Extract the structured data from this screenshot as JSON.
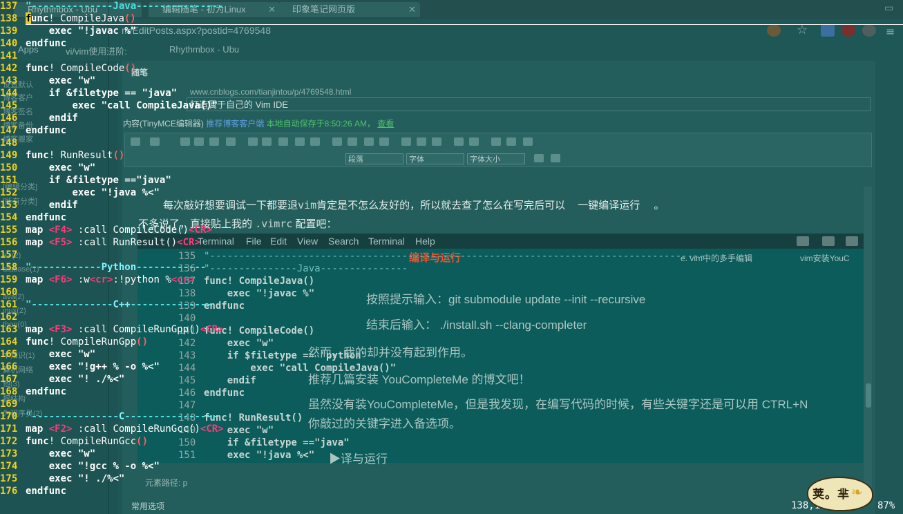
{
  "browser": {
    "tabs": [
      {
        "label": "Rhythmbox - Ubu"
      },
      {
        "label": "编辑随笔 - 初为Linux"
      },
      {
        "label": "印象笔记网页版"
      }
    ],
    "url": "m/EditPosts.aspx?postid=4769548",
    "bookmarks": [
      "Apps",
      "vi/vim使用进阶: ",
      "Rhythmbox - Ubu"
    ],
    "sidebar_items": [
      "设置默认",
      "博客客户",
      "博客签名",
      "博客备份",
      "博客搬家",
      "[编辑分类]",
      "[所有分类]",
      "++(2)",
      "atabase(1)",
      "ava(2)",
      "inux(2)",
      "thon(0)",
      "本知识(1)",
      "算机网络",
      "他(3)",
      "据结构",
      "为程序员(2)"
    ],
    "section_title": "随笔",
    "post_link": "www.cnblogs.com/tianjintou/p/4769548.html",
    "post_title": "打造属于自己的 Vim IDE",
    "content_label": "内容(TinyMCE编辑器)",
    "content_link": "推荐博客客户端",
    "autosave_note": "本地自动保存于8:50:26 AM，",
    "autosave_link": "查看",
    "format_select": "段落",
    "font_select": "字体",
    "size_select": "字体大小",
    "body_line_1": "每次敲好想要调试一下都要退",
    "body_line_1_code": "vim",
    "body_line_1_rest": "肯定是不怎么友好的，所以就去查了怎么在写完后可以",
    "body_line_1_end": "一键编译运行",
    "body_line_1_dot": "。",
    "body_line_2": "不多说了，直接贴上我的",
    "body_line_2_code": ".vimrc",
    "body_line_2_rest": "配置吧：",
    "path_label": "元素路径: p",
    "footer_label": "常用选项"
  },
  "terminal": {
    "menu": [
      "Terminal",
      "File",
      "Edit",
      "View",
      "Search",
      "Terminal",
      "Help"
    ],
    "heading": "编译与运行",
    "overlay_lines": [
      "按照提示输入：git submodule update --init --recursive",
      "结束后输入：   ./install.sh --clang-completer",
      "然而，我的却并没有起到作用。",
      "推荐几篇安装",
      "YouCompleteMe",
      "的博文吧！",
      "虽然没有装YouCompleteMe，但是我发现，在编写代码的时候，有些关键字还是可以用 CTRL+N",
      "你敲过的关键字进入备选项。",
      "e. vim中的多手编辑",
      "vim安装YouC",
      "▶译与运行"
    ],
    "code_lines": [
      {
        "n": "135",
        "t": "\"-------------------------------------------------------------------------------------"
      },
      {
        "n": "136",
        "t": "\"---------------Java---------------"
      },
      {
        "n": "137",
        "t": "func! CompileJava()"
      },
      {
        "n": "138",
        "t": "    exec \"!javac %\""
      },
      {
        "n": "139",
        "t": "endfunc"
      },
      {
        "n": "140",
        "t": ""
      },
      {
        "n": "141",
        "t": "func! CompileCode()"
      },
      {
        "n": "142",
        "t": "    exec \"w\""
      },
      {
        "n": "143",
        "t": "    if $filetype == \"python\""
      },
      {
        "n": "144",
        "t": "        exec \"call CompileJava()\""
      },
      {
        "n": "145",
        "t": "    endif"
      },
      {
        "n": "146",
        "t": "endfunc"
      },
      {
        "n": "147",
        "t": ""
      },
      {
        "n": "148",
        "t": "func! RunResult()"
      },
      {
        "n": "149",
        "t": "    exec \"w\""
      },
      {
        "n": "150",
        "t": "    if &filetype ==\"java\""
      },
      {
        "n": "151",
        "t": "    exec \"!java %<\""
      }
    ]
  },
  "vim": {
    "lines": [
      {
        "n": "137",
        "parts": [
          [
            "cmt",
            "\"--------------Java---------------"
          ]
        ]
      },
      {
        "n": "138",
        "parts": [
          [
            "cursor",
            "f"
          ],
          [
            "fn",
            "unc"
          ],
          [
            "id",
            "! CompileJava"
          ],
          [
            "paren",
            "()"
          ]
        ]
      },
      {
        "n": "139",
        "parts": [
          [
            "id",
            "    "
          ],
          [
            "fn",
            "exec"
          ],
          [
            "id",
            " "
          ],
          [
            "str",
            "\"!javac %\""
          ]
        ]
      },
      {
        "n": "140",
        "parts": [
          [
            "fn",
            "endfunc"
          ]
        ]
      },
      {
        "n": "141",
        "parts": []
      },
      {
        "n": "142",
        "parts": [
          [
            "fn",
            "func"
          ],
          [
            "id",
            "! CompileCode"
          ],
          [
            "paren",
            "()"
          ]
        ]
      },
      {
        "n": "143",
        "parts": [
          [
            "id",
            "    "
          ],
          [
            "fn",
            "exec"
          ],
          [
            "id",
            " "
          ],
          [
            "str",
            "\"w\""
          ]
        ]
      },
      {
        "n": "144",
        "parts": [
          [
            "id",
            "    "
          ],
          [
            "fn",
            "if"
          ],
          [
            "id",
            " "
          ],
          [
            "fn",
            "&filetype"
          ],
          [
            "id",
            " == "
          ],
          [
            "str",
            "\"java\""
          ]
        ]
      },
      {
        "n": "145",
        "parts": [
          [
            "id",
            "        "
          ],
          [
            "fn",
            "exec"
          ],
          [
            "id",
            " "
          ],
          [
            "str",
            "\"call CompileJava()\""
          ]
        ]
      },
      {
        "n": "146",
        "parts": [
          [
            "id",
            "    "
          ],
          [
            "fn",
            "endif"
          ]
        ]
      },
      {
        "n": "147",
        "parts": [
          [
            "fn",
            "endfunc"
          ]
        ]
      },
      {
        "n": "148",
        "parts": []
      },
      {
        "n": "149",
        "parts": [
          [
            "fn",
            "func"
          ],
          [
            "id",
            "! RunResult"
          ],
          [
            "paren",
            "()"
          ]
        ]
      },
      {
        "n": "150",
        "parts": [
          [
            "id",
            "    "
          ],
          [
            "fn",
            "exec"
          ],
          [
            "id",
            " "
          ],
          [
            "str",
            "\"w\""
          ]
        ]
      },
      {
        "n": "151",
        "parts": [
          [
            "id",
            "    "
          ],
          [
            "fn",
            "if"
          ],
          [
            "id",
            " "
          ],
          [
            "fn",
            "&filetype"
          ],
          [
            "id",
            " =="
          ],
          [
            "str",
            "\"java\""
          ]
        ]
      },
      {
        "n": "152",
        "parts": [
          [
            "id",
            "        "
          ],
          [
            "fn",
            "exec"
          ],
          [
            "id",
            " "
          ],
          [
            "str",
            "\"!java %<\""
          ]
        ]
      },
      {
        "n": "153",
        "parts": [
          [
            "id",
            "    "
          ],
          [
            "fn",
            "endif"
          ]
        ]
      },
      {
        "n": "154",
        "parts": [
          [
            "fn",
            "endfunc"
          ]
        ]
      },
      {
        "n": "155",
        "parts": [
          [
            "fn",
            "map"
          ],
          [
            "id",
            " "
          ],
          [
            "key",
            "<F4>"
          ],
          [
            "id",
            " :call CompileCode()"
          ],
          [
            "key",
            "<CR>"
          ]
        ]
      },
      {
        "n": "156",
        "parts": [
          [
            "fn",
            "map"
          ],
          [
            "id",
            " "
          ],
          [
            "key",
            "<F5>"
          ],
          [
            "id",
            " :call RunResult()"
          ],
          [
            "key",
            "<CR>"
          ]
        ]
      },
      {
        "n": "157",
        "parts": []
      },
      {
        "n": "158",
        "parts": [
          [
            "cmt",
            "\"------------"
          ],
          [
            "label",
            "Python"
          ],
          [
            "cmt",
            "------------"
          ]
        ]
      },
      {
        "n": "159",
        "parts": [
          [
            "fn",
            "map"
          ],
          [
            "id",
            " "
          ],
          [
            "key",
            "<F6>"
          ],
          [
            "id",
            " :w"
          ],
          [
            "key",
            "<cr>"
          ],
          [
            "id",
            ":!python %"
          ],
          [
            "key",
            "<cr>"
          ]
        ]
      },
      {
        "n": "160",
        "parts": []
      },
      {
        "n": "161",
        "parts": [
          [
            "cmt",
            "\"--------------"
          ],
          [
            "label",
            "C++"
          ],
          [
            "cmt",
            "--------------"
          ]
        ]
      },
      {
        "n": "162",
        "parts": []
      },
      {
        "n": "163",
        "parts": [
          [
            "fn",
            "map"
          ],
          [
            "id",
            " "
          ],
          [
            "key",
            "<F3>"
          ],
          [
            "id",
            " :call CompileRunGpp()"
          ],
          [
            "key",
            "<CR>"
          ]
        ]
      },
      {
        "n": "164",
        "parts": [
          [
            "fn",
            "func"
          ],
          [
            "id",
            "! CompileRunGpp"
          ],
          [
            "paren",
            "()"
          ]
        ]
      },
      {
        "n": "165",
        "parts": [
          [
            "id",
            "    "
          ],
          [
            "fn",
            "exec"
          ],
          [
            "id",
            " "
          ],
          [
            "str",
            "\"w\""
          ]
        ]
      },
      {
        "n": "166",
        "parts": [
          [
            "id",
            "    "
          ],
          [
            "fn",
            "exec"
          ],
          [
            "id",
            " "
          ],
          [
            "str",
            "\"!g++ % -o %<\""
          ]
        ]
      },
      {
        "n": "167",
        "parts": [
          [
            "id",
            "    "
          ],
          [
            "fn",
            "exec"
          ],
          [
            "id",
            " "
          ],
          [
            "str",
            "\"! ./%<\""
          ]
        ]
      },
      {
        "n": "168",
        "parts": [
          [
            "fn",
            "endfunc"
          ]
        ]
      },
      {
        "n": "169",
        "parts": []
      },
      {
        "n": "170",
        "parts": [
          [
            "cmt",
            "\"---------------"
          ],
          [
            "label",
            "C"
          ],
          [
            "cmt",
            "----------------"
          ]
        ]
      },
      {
        "n": "171",
        "parts": [
          [
            "fn",
            "map"
          ],
          [
            "id",
            " "
          ],
          [
            "key",
            "<F2>"
          ],
          [
            "id",
            " :call CompileRunGcc()"
          ],
          [
            "key",
            "<CR>"
          ]
        ]
      },
      {
        "n": "172",
        "parts": [
          [
            "fn",
            "func"
          ],
          [
            "id",
            "! CompileRunGcc"
          ],
          [
            "paren",
            "()"
          ]
        ]
      },
      {
        "n": "173",
        "parts": [
          [
            "id",
            "    "
          ],
          [
            "fn",
            "exec"
          ],
          [
            "id",
            " "
          ],
          [
            "str",
            "\"w\""
          ]
        ]
      },
      {
        "n": "174",
        "parts": [
          [
            "id",
            "    "
          ],
          [
            "fn",
            "exec"
          ],
          [
            "id",
            " "
          ],
          [
            "str",
            "\"!gcc % -o %<\""
          ]
        ]
      },
      {
        "n": "175",
        "parts": [
          [
            "id",
            "    "
          ],
          [
            "fn",
            "exec"
          ],
          [
            "id",
            " "
          ],
          [
            "str",
            "\"! ./%<\""
          ]
        ]
      },
      {
        "n": "176",
        "parts": [
          [
            "fn",
            "endfunc"
          ]
        ]
      }
    ],
    "status_position": "138,1",
    "status_percent": "87%"
  },
  "logo_text": "荚。芈",
  "colors": {
    "line_number": "#f2d21b",
    "comment": "#4fe0e0",
    "key": "#ff3a7a",
    "paren": "#ff5f5f",
    "terminal_bg": "#0d5c5c"
  }
}
